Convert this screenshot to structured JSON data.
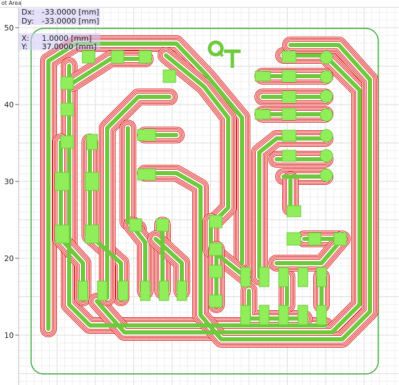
{
  "window": {
    "tab_label": "ot Area"
  },
  "readout": {
    "dx_label": "Dx:",
    "dx_value": "-33.0000 [mm]",
    "dy_label": "Dy:",
    "dy_value": "-33.0000 [mm]",
    "x_label": "X:",
    "x_value": "1.0000 [mm]",
    "y_label": "Y:",
    "y_value": "37.0000 [mm]"
  },
  "axis": {
    "y_ticks": [
      {
        "label": "50",
        "value": 50
      },
      {
        "label": "40",
        "value": 40
      },
      {
        "label": "30",
        "value": 30
      },
      {
        "label": "20",
        "value": 20
      },
      {
        "label": "10",
        "value": 10
      }
    ]
  },
  "board": {
    "logo_text": "QT"
  },
  "colors": {
    "background": "#ffffff",
    "grid_minor": "#eeeeee",
    "grid_major": "#dcdcdc",
    "outline": "#3aa83a",
    "copper_trace": "#6ec93c",
    "copper_pad": "#90ee5a",
    "isolation_path": "#dd2020",
    "readout_bg": "#d2c8f5"
  }
}
